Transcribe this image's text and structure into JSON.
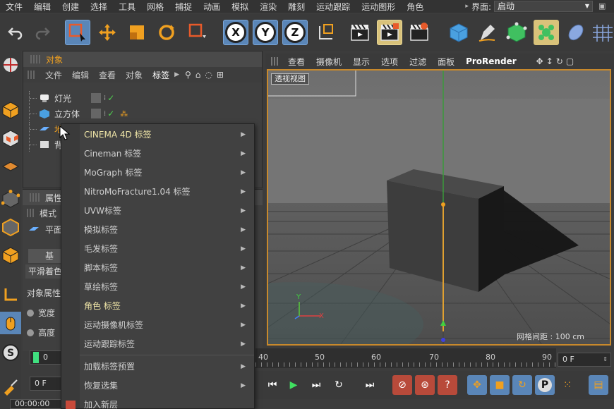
{
  "menubar": {
    "items": [
      "文件",
      "编辑",
      "创建",
      "选择",
      "工具",
      "网格",
      "捕捉",
      "动画",
      "模拟",
      "渲染",
      "雕刻",
      "运动跟踪",
      "运动图形",
      "角色"
    ],
    "layout_label": "界面:",
    "layout_value": "启动"
  },
  "toolbar": {
    "axis_x": "X",
    "axis_y": "Y",
    "axis_z": "Z"
  },
  "object_manager": {
    "title": "对象",
    "menu": [
      "文件",
      "编辑",
      "查看",
      "对象",
      "标签"
    ],
    "objects": [
      {
        "name": "灯光"
      },
      {
        "name": "立方体"
      },
      {
        "name": "地"
      },
      {
        "name": "背"
      }
    ]
  },
  "attributes": {
    "title": "属性",
    "mode_label": "模式",
    "object_label": "平面",
    "basic_label": "基",
    "phong_label": "平滑着色",
    "props_label": "对象属性",
    "width_label": "宽度",
    "height_label": "高度"
  },
  "context_menu": {
    "items": [
      {
        "label": "CINEMA 4D 标签",
        "highlight": true
      },
      {
        "label": "Cineman 标签",
        "highlight": false
      },
      {
        "label": "MoGraph 标签",
        "highlight": false
      },
      {
        "label": "NitroMoFracture1.04 标签",
        "highlight": false
      },
      {
        "label": "UVW标签",
        "highlight": false
      },
      {
        "label": "模拟标签",
        "highlight": false
      },
      {
        "label": "毛发标签",
        "highlight": false
      },
      {
        "label": "脚本标签",
        "highlight": false
      },
      {
        "label": "草绘标签",
        "highlight": false
      },
      {
        "label": "角色 标签",
        "highlight": true
      },
      {
        "label": "运动摄像机标签",
        "highlight": false
      },
      {
        "label": "运动跟踪标签",
        "highlight": false
      }
    ],
    "footer_items": [
      {
        "label": "加载标签预置"
      },
      {
        "label": "恢复选集"
      }
    ],
    "last_item": "加入新层"
  },
  "viewport": {
    "menu": [
      "查看",
      "摄像机",
      "显示",
      "选项",
      "过滤",
      "面板",
      "ProRender"
    ],
    "view_label": "透视视图",
    "grid_label": "网格间距 : 100 cm"
  },
  "timeline": {
    "ticks": [
      "40",
      "50",
      "60",
      "70",
      "80",
      "90"
    ],
    "current_frame": "0",
    "end_frame": "0 F",
    "start_field": "0 F",
    "time_display": "00:00:00"
  },
  "colors": {
    "accent_blue": "#5a86b8",
    "viewport_border": "#c8892c",
    "highlight_text": "#f0e6a8"
  }
}
